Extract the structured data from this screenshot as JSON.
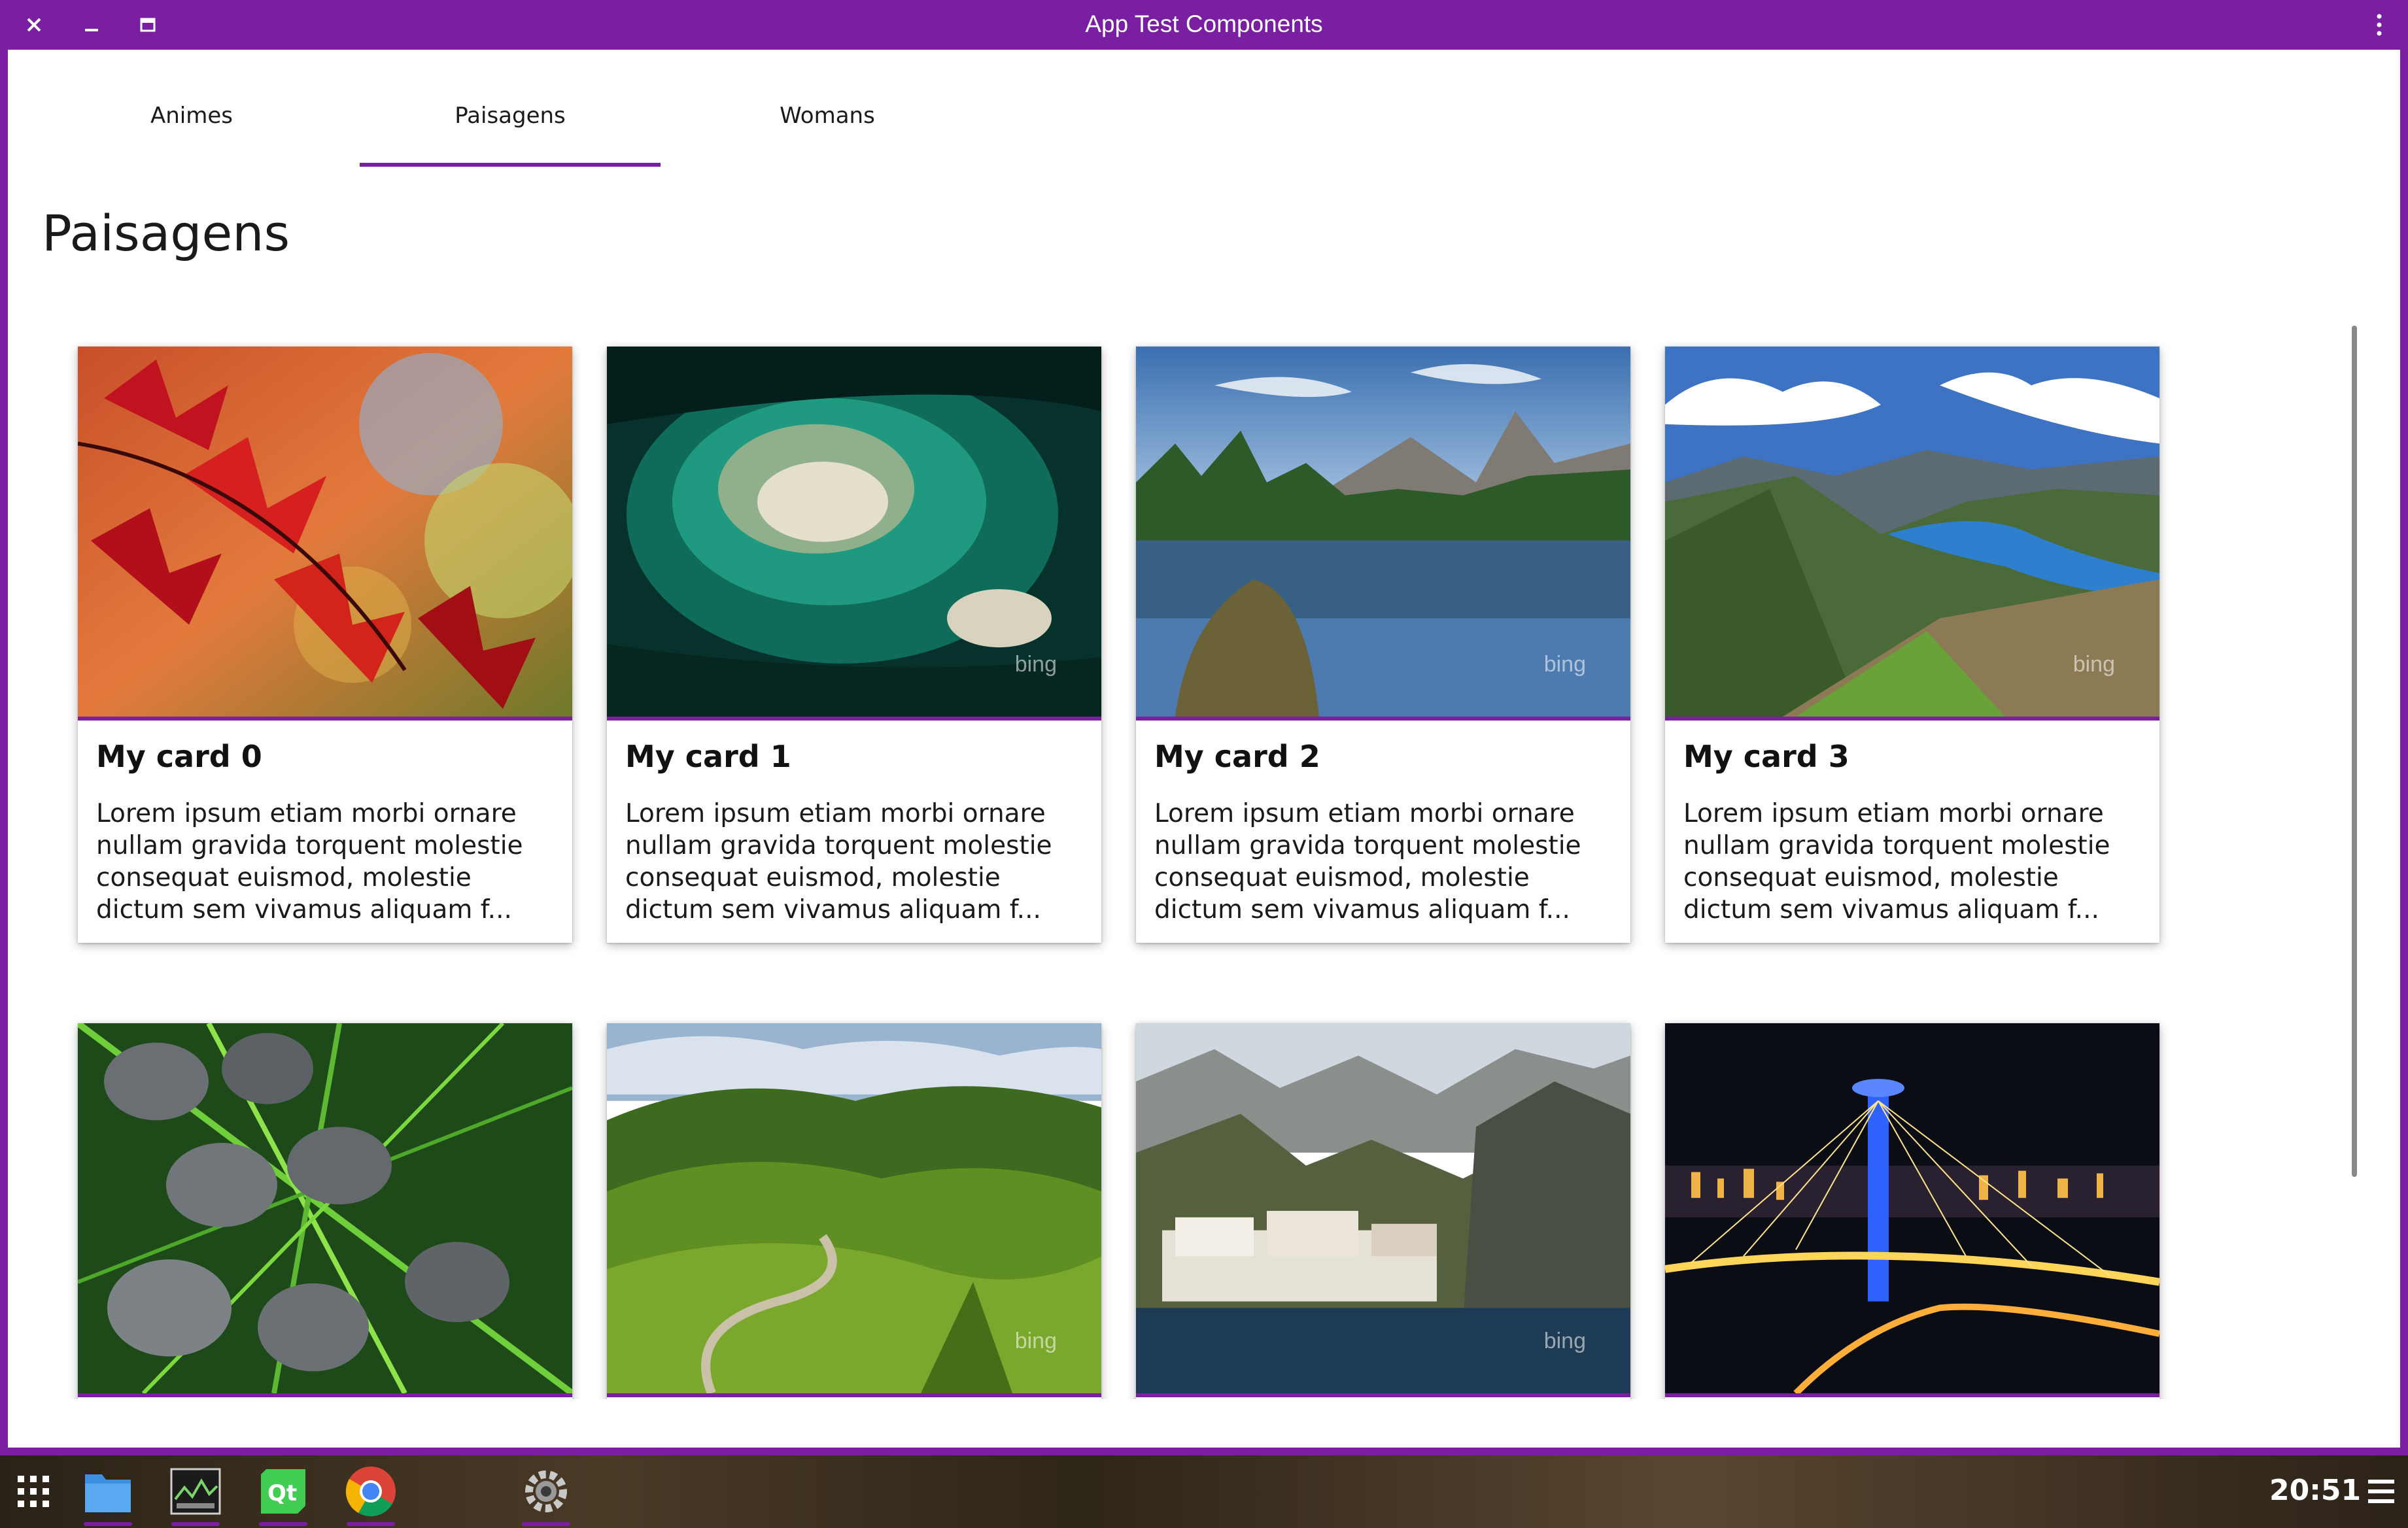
{
  "window": {
    "title": "App Test Components"
  },
  "tabs": [
    {
      "label": "Animes"
    },
    {
      "label": "Paisagens",
      "selected": true
    },
    {
      "label": "Womans"
    }
  ],
  "page": {
    "title": "Paisagens"
  },
  "cards": [
    {
      "title": "My card 0",
      "text": "Lorem ipsum etiam morbi ornare nullam gravida torquent molestie consequat euismod, molestie dictum sem vivamus aliquam f...",
      "image": "red-maple-leaves"
    },
    {
      "title": "My card 1",
      "text": "Lorem ipsum etiam morbi ornare nullam gravida torquent molestie consequat euismod, molestie dictum sem vivamus aliquam f...",
      "image": "aerial-island-reef",
      "watermark": "bing"
    },
    {
      "title": "My card 2",
      "text": "Lorem ipsum etiam morbi ornare nullam gravida torquent molestie consequat euismod, molestie dictum sem vivamus aliquam f...",
      "image": "mountain-lake-reflection",
      "watermark": "bing"
    },
    {
      "title": "My card 3",
      "text": "Lorem ipsum etiam morbi ornare nullam gravida torquent molestie consequat euismod, molestie dictum sem vivamus aliquam f...",
      "image": "fjord-valley",
      "watermark": "bing"
    },
    {
      "image": "keyboard-keys-grass"
    },
    {
      "image": "green-hills-road",
      "watermark": "bing"
    },
    {
      "image": "coastal-cliff-village",
      "watermark": "bing"
    },
    {
      "image": "night-bridge-tower"
    }
  ],
  "taskbar": {
    "apps": [
      "app-grid-icon",
      "files-icon",
      "system-monitor-icon",
      "qt-creator-icon",
      "chrome-icon",
      "settings-icon"
    ],
    "clock": "20:51"
  },
  "colors": {
    "accent": "#7a1fa2"
  }
}
